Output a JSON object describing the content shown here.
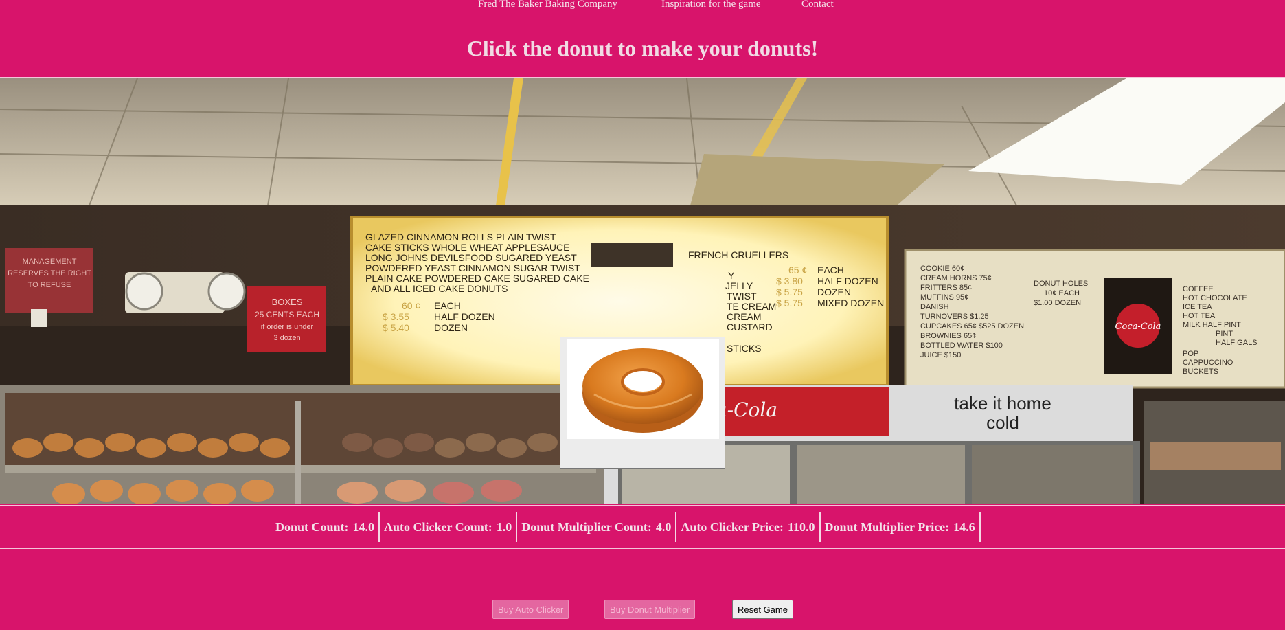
{
  "nav": {
    "links": [
      "Fred The Baker Baking Company",
      "Inspiration for the game",
      "Contact"
    ]
  },
  "header": {
    "title": "Click the donut to make your donuts!"
  },
  "scene": {
    "menu_left": {
      "lines": [
        "GLAZED CINNAMON ROLLS PLAIN TWIST",
        "CAKE STICKS WHOLE WHEAT APPLESAUCE",
        "LONG JOHNS DEVILSFOOD SUGARED YEAST",
        "POWDERED YEAST CINNAMON SUGAR TWIST",
        "PLAIN CAKE POWDERED CAKE SUGARED CAKE",
        "AND ALL ICED CAKE DONUTS"
      ],
      "prices": [
        {
          "price": "60 ¢",
          "unit": "EACH"
        },
        {
          "price": "$ 3.55",
          "unit": "HALF DOZEN"
        },
        {
          "price": "$ 5.40",
          "unit": "DOZEN"
        }
      ]
    },
    "menu_right": {
      "heading": "FRENCH CRUELLERS",
      "lines": [
        "Y",
        "JELLY",
        "TWIST",
        "TE CREAM",
        "CREAM",
        "CUSTARD",
        "STICKS"
      ],
      "prices": [
        {
          "price": "65 ¢",
          "unit": "EACH"
        },
        {
          "price": "$ 3.80",
          "unit": "HALF DOZEN"
        },
        {
          "price": "$ 5.75",
          "unit": "DOZEN"
        },
        {
          "price": "$ 5.75",
          "unit": "MIXED DOZEN"
        }
      ]
    },
    "board_far_right": {
      "lines": [
        "COOKIE 60¢",
        "CREAM HORNS 75¢",
        "FRITTERS 85¢",
        "MUFFINS 95¢",
        "DANISH TURNOVERS $1.25",
        "CUPCAKES 65¢ $525 DOZEN",
        "BROWNIES 65¢",
        "BOTTLED WATER $100",
        "JUICE $150"
      ],
      "side": [
        "DONUT HOLES",
        "10¢ EACH",
        "$1.00 DOZEN"
      ],
      "drinks": [
        "COFFEE",
        "HOT CHOCOLATE",
        "ICE TEA",
        "HOT TEA",
        "MILK HALF PINT",
        "PINT",
        "HALF GALS",
        "POP",
        "CAPPUCCINO",
        "BUCKETS"
      ]
    },
    "sign_management": "MANAGEMENT RESERVES THE RIGHT TO REFUSE",
    "sign_boxes": [
      "BOXES",
      "25 CENTS EACH",
      "if order is under",
      "3 dozen"
    ],
    "cola_logo": "Coca-Cola",
    "cooler_text": [
      "take it home",
      "cold"
    ]
  },
  "stats": {
    "donut_count_label": "Donut Count:",
    "donut_count": "14.0",
    "auto_clicker_count_label": "Auto Clicker Count:",
    "auto_clicker_count": "1.0",
    "donut_multiplier_count_label": "Donut Multiplier Count:",
    "donut_multiplier_count": "4.0",
    "auto_clicker_price_label": "Auto Clicker Price:",
    "auto_clicker_price": "110.0",
    "donut_multiplier_price_label": "Donut Multiplier Price:",
    "donut_multiplier_price": "14.6"
  },
  "buttons": {
    "buy_auto_clicker": "Buy Auto Clicker",
    "buy_donut_multiplier": "Buy Donut Multiplier",
    "reset_game": "Reset Game"
  },
  "colors": {
    "page_bg": "#d8146b",
    "text_light": "#f1dbe4"
  }
}
